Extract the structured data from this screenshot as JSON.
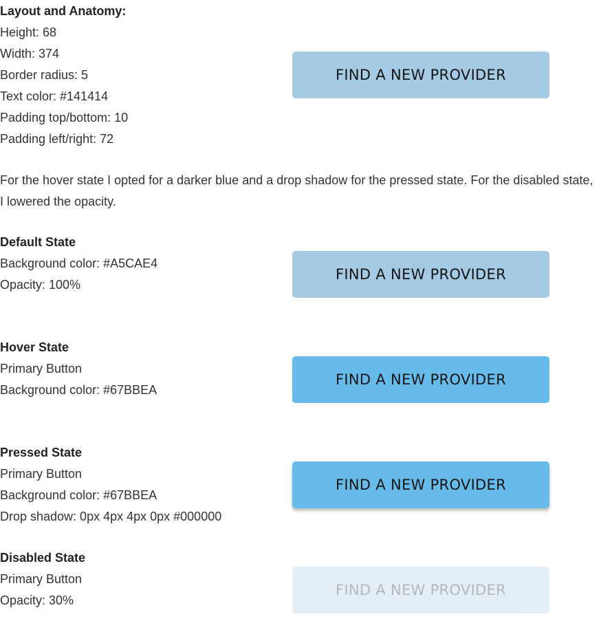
{
  "layout_section": {
    "heading": "Layout and Anatomy:",
    "lines": [
      "Height: 68",
      "Width: 374",
      "Border radius: 5",
      "Text color: #141414",
      "Padding top/bottom: 10",
      "Padding left/right: 72"
    ]
  },
  "description": "For the hover state I opted for a darker blue and a drop shadow for the pressed state.  For the disabled state, I lowered the opacity.",
  "button_label": "FIND A NEW PROVIDER",
  "states": {
    "default": {
      "heading": "Default State",
      "lines": [
        "Background color: #A5CAE4",
        "Opacity: 100%"
      ]
    },
    "hover": {
      "heading": "Hover State",
      "lines": [
        "Primary Button",
        "Background color: #67BBEA"
      ]
    },
    "pressed": {
      "heading": "Pressed State",
      "lines": [
        "Primary Button",
        "Background color: #67BBEA",
        "Drop shadow: 0px 4px 4px 0px #000000"
      ]
    },
    "disabled": {
      "heading": "Disabled State",
      "lines": [
        "Primary Button",
        "Opacity: 30%"
      ]
    }
  },
  "colors": {
    "default_bg": "#A5CAE4",
    "hover_bg": "#67BBEA",
    "text": "#141414"
  }
}
